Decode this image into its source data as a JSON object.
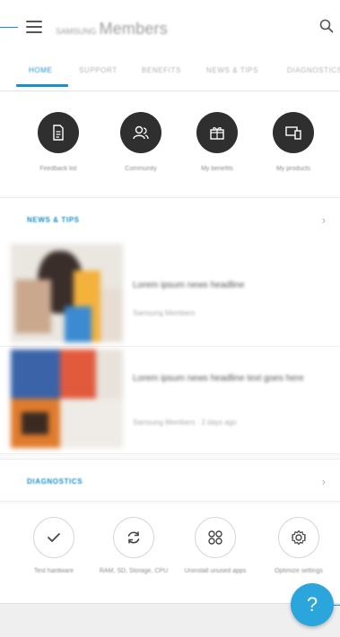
{
  "header": {
    "brand_prefix": "SAMSUNG",
    "brand_title": "Members",
    "menu_icon": "hamburger-menu-icon",
    "search_icon": "search-icon"
  },
  "tabs": [
    {
      "label": "HOME",
      "active": true
    },
    {
      "label": "SUPPORT",
      "active": false
    },
    {
      "label": "BENEFITS",
      "active": false
    },
    {
      "label": "NEWS & TIPS",
      "active": false
    },
    {
      "label": "DIAGNOSTICS",
      "active": false
    }
  ],
  "shortcuts": [
    {
      "label": "Feedback list",
      "icon": "document-icon"
    },
    {
      "label": "Community",
      "icon": "community-icon"
    },
    {
      "label": "My benefits",
      "icon": "gift-icon"
    },
    {
      "label": "My products",
      "icon": "devices-icon"
    }
  ],
  "news_section": {
    "title": "NEWS & TIPS",
    "chevron": "›"
  },
  "news": [
    {
      "title": "Lorem ipsum news headline",
      "sub": "Samsung Members"
    },
    {
      "title": "Lorem ipsum news headline text goes here",
      "sub": "Samsung Members · 2 days ago"
    }
  ],
  "diagnostics_section": {
    "title": "DIAGNOSTICS",
    "chevron": "›"
  },
  "diagnostics": [
    {
      "label": "Test hardware",
      "icon": "check-icon"
    },
    {
      "label": "RAM, SD, Storage, CPU",
      "icon": "refresh-icon"
    },
    {
      "label": "Uninstall unused apps",
      "icon": "apps-grid-icon"
    },
    {
      "label": "Optimize settings",
      "icon": "settings-gear-icon"
    }
  ],
  "fab": {
    "label": "?",
    "icon": "help-icon"
  },
  "colors": {
    "accent": "#1a8fc7",
    "fab": "#2aa6dc",
    "circle": "#2f2f2f"
  }
}
